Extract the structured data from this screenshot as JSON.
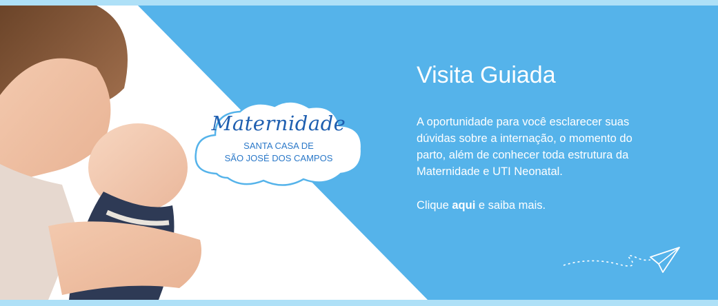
{
  "colors": {
    "panel_blue": "#55b3ea",
    "strip_blue": "#aee0f7",
    "badge_blue": "#1f5fb0",
    "text_white": "#ffffff"
  },
  "badge": {
    "title": "Maternidade",
    "line1": "SANTA CASA DE",
    "line2": "SÃO JOSÉ DOS CAMPOS"
  },
  "headline": "Visita Guiada",
  "body": "A oportunidade para você  esclarecer suas\ndúvidas sobre a internação, o momento do\nparto, além de conhecer  toda estrutura  da\nMaternidade e UTI Neonatal.",
  "cta": {
    "prefix": "Clique ",
    "link_label": "aqui",
    "suffix": " e saiba mais."
  },
  "icons": {
    "plane": "paper-plane-icon"
  }
}
